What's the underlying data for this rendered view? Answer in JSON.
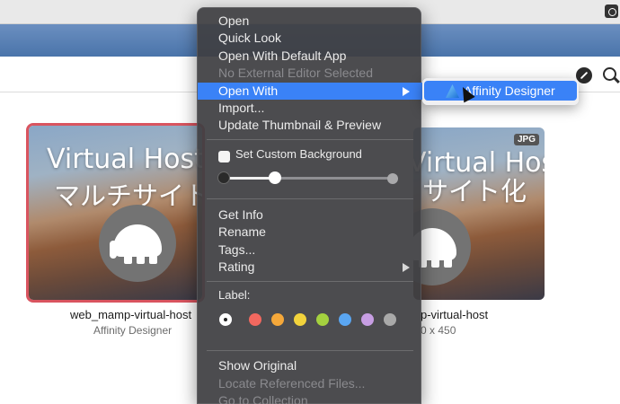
{
  "toolbar": {
    "icons": [
      "camera-icon",
      "compass-icon",
      "search-icon"
    ]
  },
  "thumbnails": [
    {
      "title_line1": "Virtual Host",
      "title_line2": "マルチサイト",
      "filename": "web_mamp-virtual-host",
      "subtitle": "Affinity Designer",
      "selected": true,
      "icon": "elephant-icon"
    },
    {
      "title_line1": "Virtual Hostで",
      "title_line2": "サイト化",
      "badge": "JPG",
      "filename": "p-virtual-host",
      "subtitle": "0 x 450",
      "selected": false,
      "icon": "elephant-icon"
    }
  ],
  "menu": {
    "items": [
      {
        "label": "Open",
        "enabled": true
      },
      {
        "label": "Quick Look",
        "enabled": true
      },
      {
        "label": "Open With Default App",
        "enabled": true
      },
      {
        "label": "No External Editor Selected",
        "enabled": false
      },
      {
        "label": "Open With",
        "enabled": true,
        "highlighted": true,
        "submenu": true
      },
      {
        "label": "Import...",
        "enabled": true
      },
      {
        "label": "Update Thumbnail & Preview",
        "enabled": true
      },
      {
        "label": "Set Custom Background",
        "checkbox": true,
        "checked": false
      },
      {
        "label": "Get Info",
        "enabled": true
      },
      {
        "label": "Rename",
        "enabled": true
      },
      {
        "label": "Tags...",
        "enabled": true
      },
      {
        "label": "Rating",
        "enabled": true,
        "submenu": true
      },
      {
        "label": "Label:",
        "enabled": true
      },
      {
        "label": "Show Original",
        "enabled": true
      },
      {
        "label": "Locate Referenced Files...",
        "enabled": false
      },
      {
        "label": "Go to Collection",
        "enabled": false
      }
    ],
    "background_slider_value": 0.3,
    "label_colors": [
      "none",
      "#f2685f",
      "#f5a83a",
      "#f2d33c",
      "#a4d13f",
      "#5aa6f2",
      "#c79ee3",
      "#a9a9a9"
    ]
  },
  "submenu": {
    "item_label": "Affinity Designer",
    "item_icon": "affinity-designer-icon"
  },
  "colors": {
    "highlight": "#3a82f7",
    "selection_border": "#d9545f",
    "menu_bg": "#3e3e42"
  }
}
